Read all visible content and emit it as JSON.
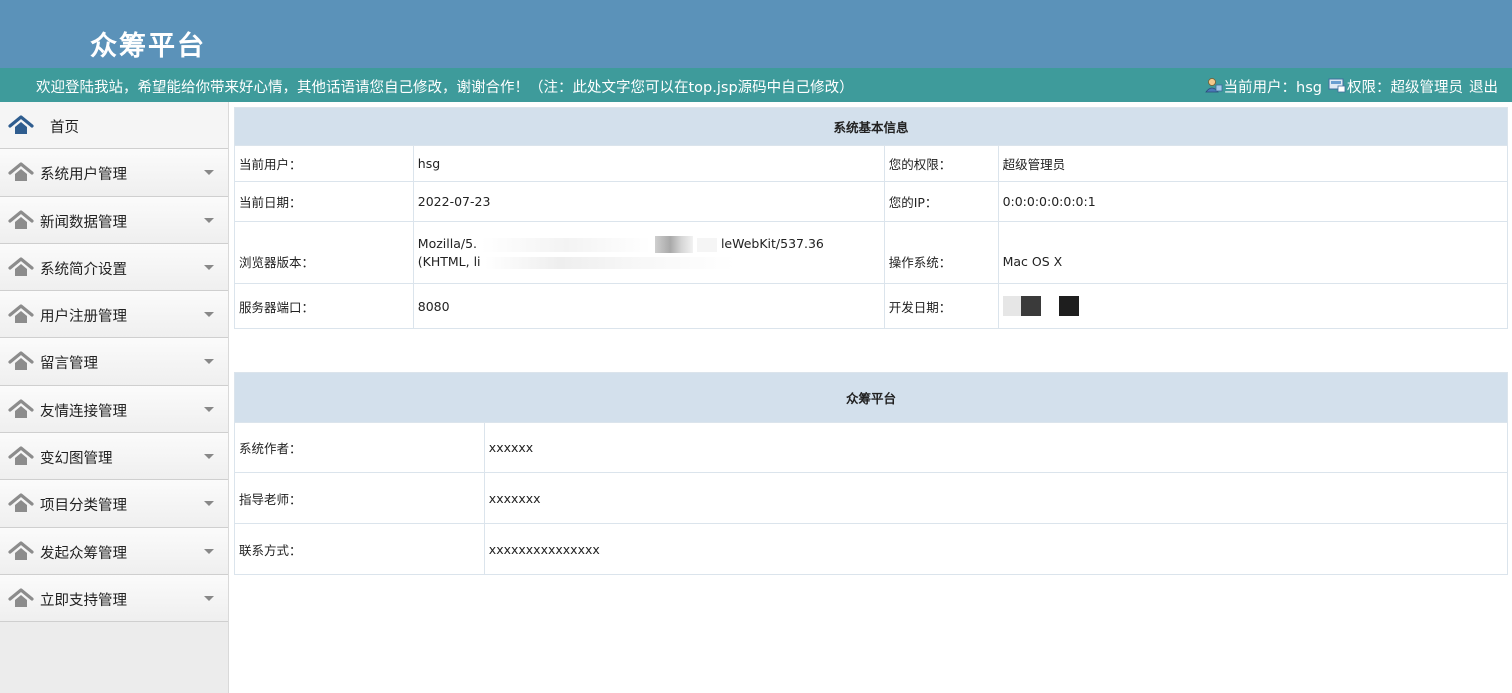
{
  "header": {
    "title": "众筹平台"
  },
  "welcome": {
    "text": "欢迎登陆我站，希望能给你带来好心情，其他话语请您自己修改，谢谢合作！（注：此处文字您可以在top.jsp源码中自己修改）",
    "current_user_label": "当前用户：hsg",
    "role_label": "权限：超级管理员",
    "logout": "退出"
  },
  "sidebar": {
    "items": [
      {
        "label": "首页",
        "icon": "home-icon"
      },
      {
        "label": "系统用户管理",
        "icon": "roof-icon"
      },
      {
        "label": "新闻数据管理",
        "icon": "roof-icon"
      },
      {
        "label": "系统简介设置",
        "icon": "roof-icon"
      },
      {
        "label": "用户注册管理",
        "icon": "roof-icon"
      },
      {
        "label": "留言管理",
        "icon": "roof-icon"
      },
      {
        "label": "友情连接管理",
        "icon": "roof-icon"
      },
      {
        "label": "变幻图管理",
        "icon": "roof-icon"
      },
      {
        "label": "项目分类管理",
        "icon": "roof-icon"
      },
      {
        "label": "发起众筹管理",
        "icon": "roof-icon"
      },
      {
        "label": "立即支持管理",
        "icon": "roof-icon"
      }
    ]
  },
  "system_info": {
    "heading": "系统基本信息",
    "rows": [
      {
        "label1": "当前用户：",
        "value1": "hsg",
        "label2": "您的权限：",
        "value2": "超级管理员"
      },
      {
        "label1": "当前日期：",
        "value1": "2022-07-23",
        "label2": "您的IP：",
        "value2": "0:0:0:0:0:0:0:1"
      },
      {
        "label1": "浏览器版本：",
        "value1_line1_a": "Mozilla/5.",
        "value1_line1_b": "leWebKit/537.36",
        "value1_line2": "(KHTML, li",
        "label2": "操作系统：",
        "value2": "Mac OS X"
      },
      {
        "label1": "服务器端口：",
        "value1": "8080",
        "label2": "开发日期：",
        "value2": ""
      }
    ]
  },
  "platform_info": {
    "heading": "众筹平台",
    "rows": [
      {
        "label": "系统作者：",
        "value": "xxxxxx"
      },
      {
        "label": "指导老师：",
        "value": "xxxxxxx"
      },
      {
        "label": "联系方式：",
        "value": "xxxxxxxxxxxxxxx"
      }
    ]
  },
  "colors": {
    "header_bg": "#5b92b9",
    "welcome_bg": "#3e9b9b",
    "table_heading_bg": "#d3e0ec",
    "sidebar_bg": "#ececec"
  }
}
